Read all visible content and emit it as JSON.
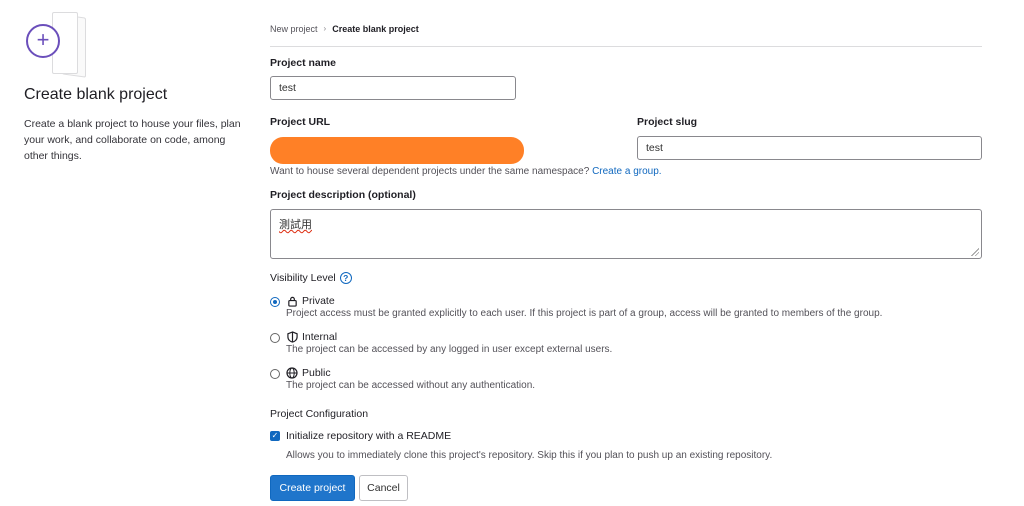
{
  "left": {
    "title": "Create blank project",
    "description": "Create a blank project to house your files, plan your work, and collaborate on code, among other things.",
    "icon": "plus-circle-icon"
  },
  "breadcrumb": {
    "items": [
      "New project",
      "Create blank project"
    ]
  },
  "form": {
    "project_name_label": "Project name",
    "project_name_value": "test",
    "project_url_label": "Project URL",
    "project_slug_label": "Project slug",
    "project_slug_value": "test",
    "namespace_help": "Want to house several dependent projects under the same namespace?",
    "namespace_link": "Create a group.",
    "description_label": "Project description (optional)",
    "description_value": "測試用",
    "visibility_label": "Visibility Level",
    "visibility": [
      {
        "label": "Private",
        "desc": "Project access must be granted explicitly to each user. If this project is part of a group, access will be granted to members of the group.",
        "checked": true,
        "icon": "lock-icon"
      },
      {
        "label": "Internal",
        "desc": "The project can be accessed by any logged in user except external users.",
        "checked": false,
        "icon": "shield-icon"
      },
      {
        "label": "Public",
        "desc": "The project can be accessed without any authentication.",
        "checked": false,
        "icon": "globe-icon"
      }
    ],
    "config_label": "Project Configuration",
    "readme_label": "Initialize repository with a README",
    "readme_checked": true,
    "readme_help": "Allows you to immediately clone this project's repository. Skip this if you plan to push up an existing repository.",
    "create_button": "Create project",
    "cancel_button": "Cancel"
  },
  "colors": {
    "primary": "#1f75cb",
    "link": "#1068bf",
    "redaction": "#ff8026",
    "illustration_accent": "#6b4fbb"
  }
}
